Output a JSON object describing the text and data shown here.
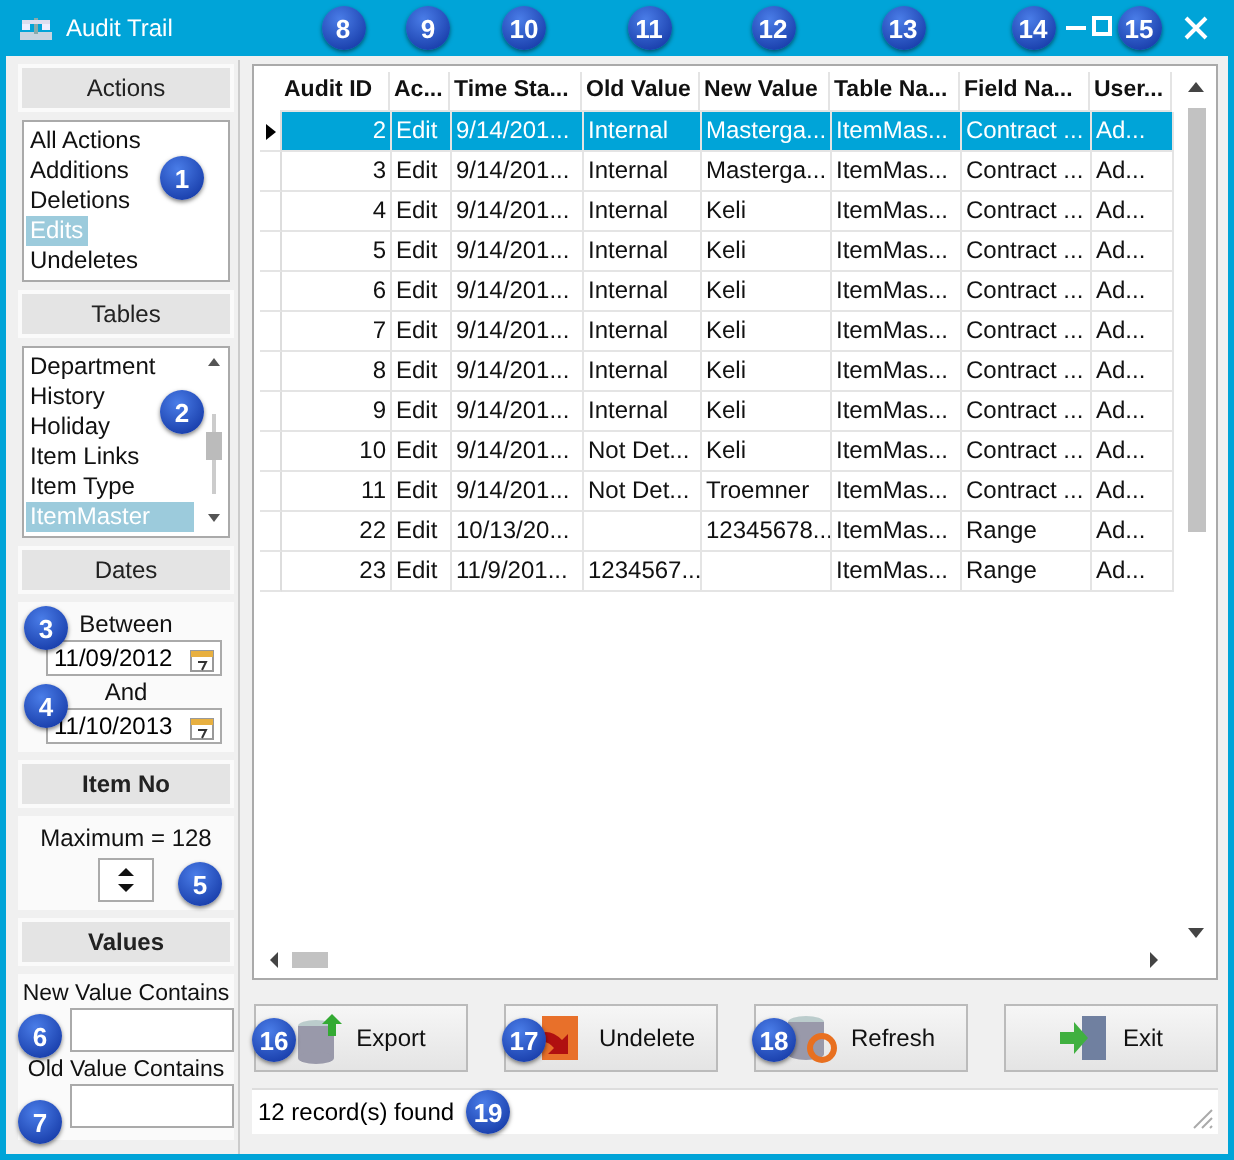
{
  "window": {
    "title": "Audit Trail"
  },
  "filters": {
    "actions": {
      "heading": "Actions",
      "callout": "1",
      "items": [
        {
          "label": "All Actions",
          "selected": false
        },
        {
          "label": "Additions",
          "selected": false
        },
        {
          "label": "Deletions",
          "selected": false
        },
        {
          "label": "Edits",
          "selected": true
        },
        {
          "label": "Undeletes",
          "selected": false
        }
      ]
    },
    "tables": {
      "heading": "Tables",
      "callout": "2",
      "items": [
        {
          "label": "Department",
          "selected": false
        },
        {
          "label": "History",
          "selected": false
        },
        {
          "label": "Holiday",
          "selected": false
        },
        {
          "label": "Item Links",
          "selected": false
        },
        {
          "label": "Item Type",
          "selected": false
        },
        {
          "label": "ItemMaster",
          "selected": true
        }
      ]
    },
    "dates": {
      "heading": "Dates",
      "between_label": "Between",
      "between_value": "11/09/2012",
      "between_callout": "3",
      "and_label": "And",
      "and_value": "11/10/2013",
      "and_callout": "4"
    },
    "item_no": {
      "heading": "Item No",
      "maximum_label": "Maximum = 128",
      "callout": "5"
    },
    "values": {
      "heading": "Values",
      "new_label": "New Value Contains",
      "new_callout": "6",
      "old_label": "Old Value Contains",
      "old_callout": "7"
    }
  },
  "table": {
    "columns": [
      {
        "label": "Audit ID",
        "callout": "8"
      },
      {
        "label": "Ac...",
        "callout": "9"
      },
      {
        "label": "Time Sta...",
        "callout": "10"
      },
      {
        "label": "Old Value",
        "callout": "11"
      },
      {
        "label": "New Value",
        "callout": "12"
      },
      {
        "label": "Table Na...",
        "callout": "13"
      },
      {
        "label": "Field Na...",
        "callout": "14"
      },
      {
        "label": "User...",
        "callout": "15"
      }
    ],
    "rows": [
      {
        "selected": true,
        "cells": [
          "2",
          "Edit",
          "9/14/201...",
          "Internal",
          "Masterga...",
          "ItemMas...",
          "Contract ...",
          "Ad..."
        ]
      },
      {
        "selected": false,
        "cells": [
          "3",
          "Edit",
          "9/14/201...",
          "Internal",
          "Masterga...",
          "ItemMas...",
          "Contract ...",
          "Ad..."
        ]
      },
      {
        "selected": false,
        "cells": [
          "4",
          "Edit",
          "9/14/201...",
          "Internal",
          "Keli",
          "ItemMas...",
          "Contract ...",
          "Ad..."
        ]
      },
      {
        "selected": false,
        "cells": [
          "5",
          "Edit",
          "9/14/201...",
          "Internal",
          "Keli",
          "ItemMas...",
          "Contract ...",
          "Ad..."
        ]
      },
      {
        "selected": false,
        "cells": [
          "6",
          "Edit",
          "9/14/201...",
          "Internal",
          "Keli",
          "ItemMas...",
          "Contract ...",
          "Ad..."
        ]
      },
      {
        "selected": false,
        "cells": [
          "7",
          "Edit",
          "9/14/201...",
          "Internal",
          "Keli",
          "ItemMas...",
          "Contract ...",
          "Ad..."
        ]
      },
      {
        "selected": false,
        "cells": [
          "8",
          "Edit",
          "9/14/201...",
          "Internal",
          "Keli",
          "ItemMas...",
          "Contract ...",
          "Ad..."
        ]
      },
      {
        "selected": false,
        "cells": [
          "9",
          "Edit",
          "9/14/201...",
          "Internal",
          "Keli",
          "ItemMas...",
          "Contract ...",
          "Ad..."
        ]
      },
      {
        "selected": false,
        "cells": [
          "10",
          "Edit",
          "9/14/201...",
          "Not Det...",
          "Keli",
          "ItemMas...",
          "Contract ...",
          "Ad..."
        ]
      },
      {
        "selected": false,
        "cells": [
          "11",
          "Edit",
          "9/14/201...",
          "Not Det...",
          "Troemner",
          "ItemMas...",
          "Contract ...",
          "Ad..."
        ]
      },
      {
        "selected": false,
        "cells": [
          "22",
          "Edit",
          "10/13/20...",
          "",
          "12345678...",
          "ItemMas...",
          "Range",
          "Ad..."
        ]
      },
      {
        "selected": false,
        "cells": [
          "23",
          "Edit",
          "11/9/201...",
          "1234567...",
          "",
          "ItemMas...",
          "Range",
          "Ad..."
        ]
      }
    ]
  },
  "buttons": [
    {
      "kind": "export",
      "label": "Export",
      "callout": "16"
    },
    {
      "kind": "undelete",
      "label": "Undelete",
      "callout": "17"
    },
    {
      "kind": "refresh",
      "label": "Refresh",
      "callout": "18"
    },
    {
      "kind": "exit",
      "label": "Exit"
    }
  ],
  "status": {
    "text": "12 record(s) found",
    "callout": "19"
  }
}
